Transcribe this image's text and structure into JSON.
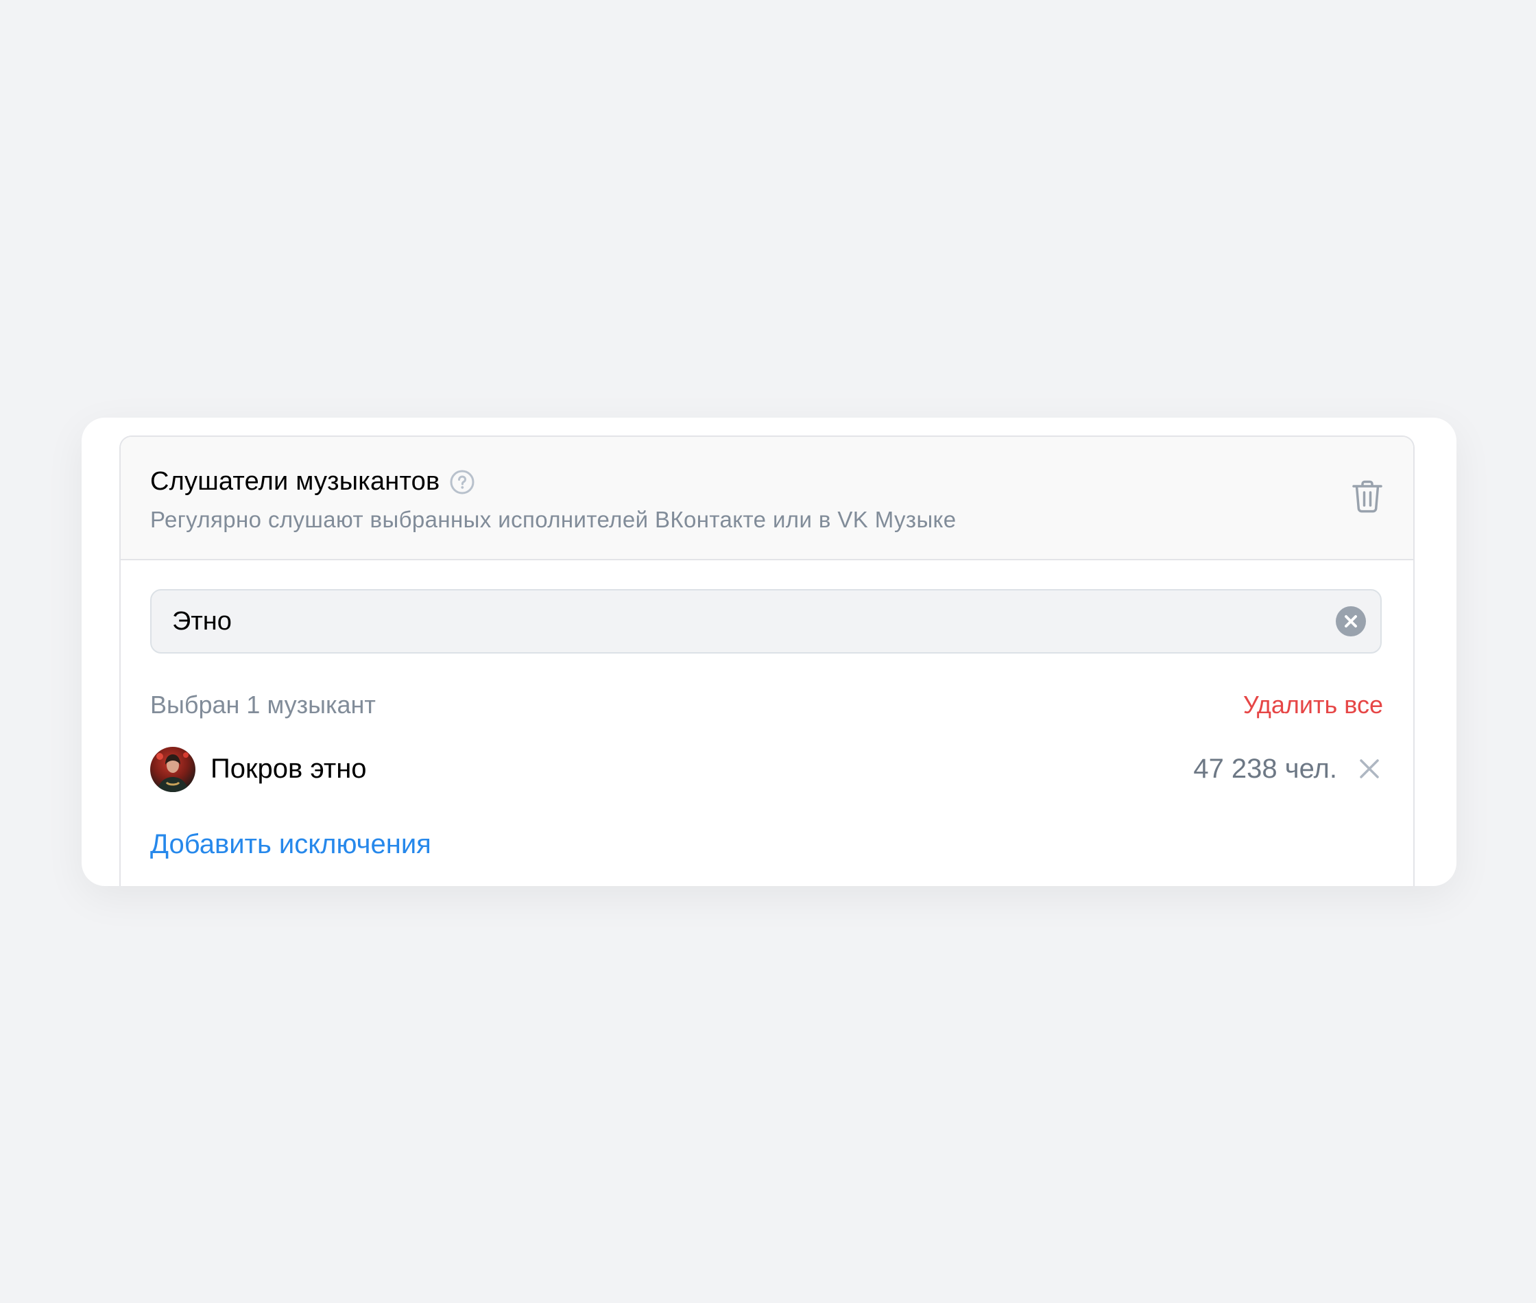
{
  "card": {
    "title": "Слушатели музыкантов",
    "subtitle": "Регулярно слушают выбранных исполнителей ВКонтакте или в VK Музыке",
    "icons": {
      "help": "help-circle-icon",
      "delete": "trash-icon"
    }
  },
  "search": {
    "value": "Этно",
    "clear_icon": "clear-circle-icon"
  },
  "selection": {
    "count_label": "Выбран 1 музыкант",
    "remove_all_label": "Удалить все"
  },
  "musicians": [
    {
      "name": "Покров этно",
      "audience": "47 238 чел.",
      "remove_icon": "close-icon"
    }
  ],
  "add_exclusions_label": "Добавить исключения",
  "colors": {
    "page_background": "#f2f3f5",
    "accent_link": "#2688eb",
    "destructive": "#e64646",
    "secondary_text": "#818c99"
  }
}
